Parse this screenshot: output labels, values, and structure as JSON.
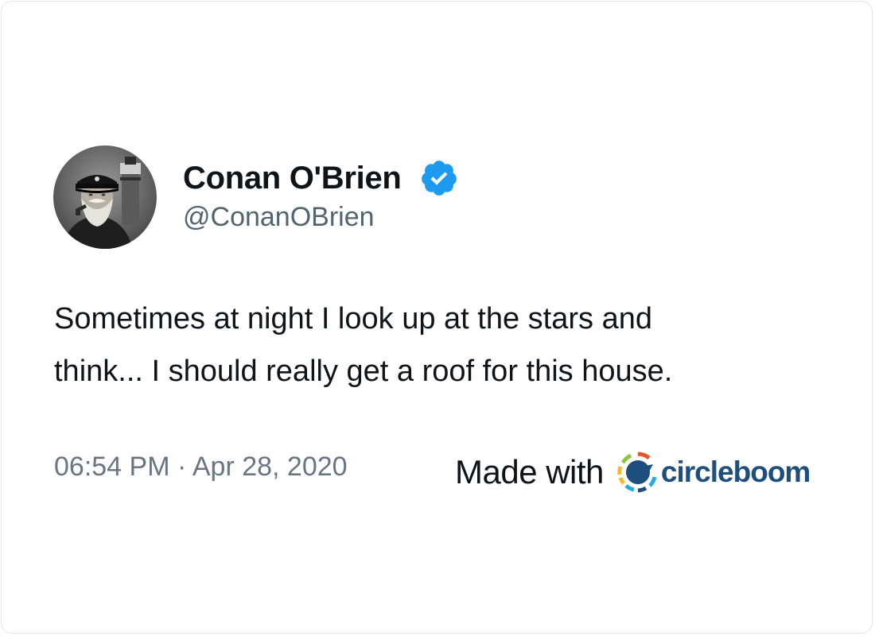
{
  "author": {
    "name": "Conan O'Brien",
    "handle": "@ConanOBrien",
    "verified": true,
    "avatar_icon": "sea-captain-portrait"
  },
  "tweet": {
    "text": "Sometimes at night I look up at the stars and\nthink... I should really get a roof for this house.",
    "timestamp": "06:54 PM · Apr 28, 2020"
  },
  "branding": {
    "made_with_label": "Made with",
    "brand_name": "circleboom",
    "icon": "circleboom-logo-icon"
  },
  "colors": {
    "verified_blue": "#1d9bf0",
    "text_primary": "#0f1419",
    "text_secondary": "#536471",
    "brand_navy": "#1d4e7e"
  }
}
